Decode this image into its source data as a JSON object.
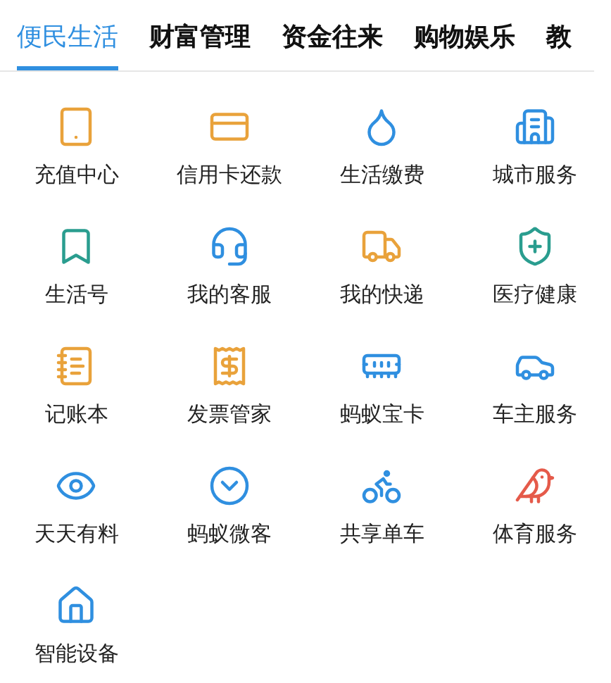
{
  "tabs": [
    {
      "label": "便民生活",
      "selected": true
    },
    {
      "label": "财富管理",
      "selected": false
    },
    {
      "label": "资金往来",
      "selected": false
    },
    {
      "label": "购物娱乐",
      "selected": false
    },
    {
      "label": "教",
      "selected": false
    }
  ],
  "services": [
    {
      "label": "充值中心",
      "color": "#e9a23b"
    },
    {
      "label": "信用卡还款",
      "color": "#e9a23b"
    },
    {
      "label": "生活缴费",
      "color": "#2f8fe0"
    },
    {
      "label": "城市服务",
      "color": "#2f8fe0"
    },
    {
      "label": "生活号",
      "color": "#2a9d8f"
    },
    {
      "label": "我的客服",
      "color": "#2f8fe0"
    },
    {
      "label": "我的快递",
      "color": "#e9a23b"
    },
    {
      "label": "医疗健康",
      "color": "#2a9d8f"
    },
    {
      "label": "记账本",
      "color": "#e9a23b"
    },
    {
      "label": "发票管家",
      "color": "#e9a23b"
    },
    {
      "label": "蚂蚁宝卡",
      "color": "#2f8fe0"
    },
    {
      "label": "车主服务",
      "color": "#2f8fe0"
    },
    {
      "label": "天天有料",
      "color": "#2f8fe0"
    },
    {
      "label": "蚂蚁微客",
      "color": "#2f8fe0"
    },
    {
      "label": "共享单车",
      "color": "#2f8fe0"
    },
    {
      "label": "体育服务",
      "color": "#e55a4a"
    },
    {
      "label": "智能设备",
      "color": "#2f8fe0"
    }
  ]
}
